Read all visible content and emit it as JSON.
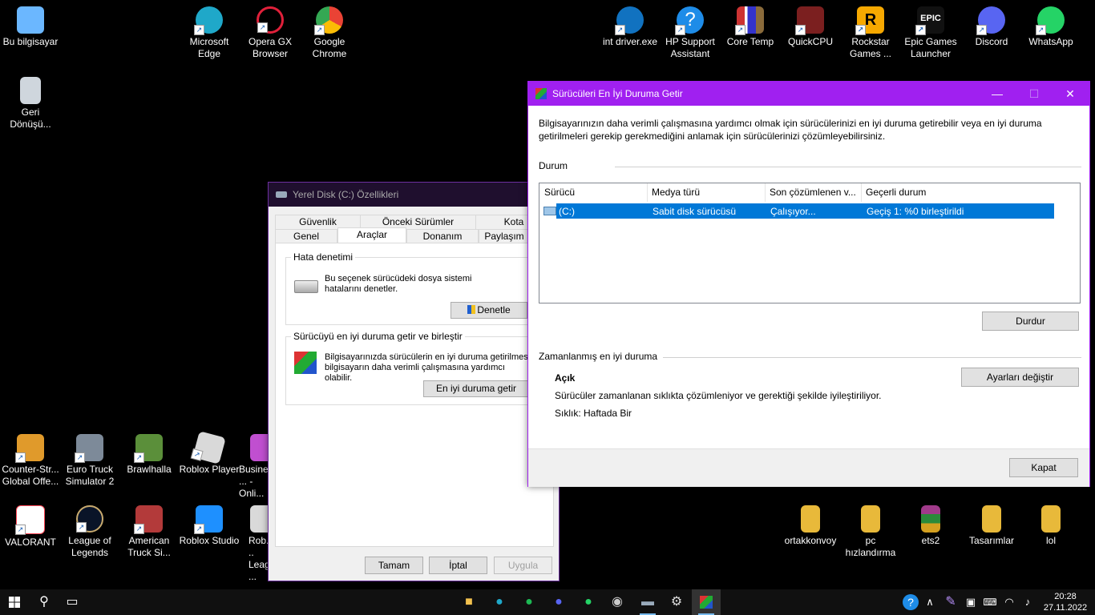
{
  "desktop": {
    "icons": [
      {
        "label": "Bu bilgisayar",
        "icon": "computer-icon",
        "color": "#6bb7ff"
      },
      {
        "label": "Geri Dönüşü...",
        "icon": "recycle-bin-icon",
        "color": "#cfd6dd"
      },
      {
        "label": "Microsoft Edge",
        "icon": "edge-icon",
        "color": "#1fa8c9"
      },
      {
        "label": "Opera GX Browser",
        "icon": "opera-gx-icon",
        "color": "#e0203a"
      },
      {
        "label": "Google Chrome",
        "icon": "chrome-icon",
        "color": "#4caf50"
      },
      {
        "label": "int driver.exe",
        "icon": "hp-icon",
        "color": "#1172c0"
      },
      {
        "label": "HP Support Assistant",
        "icon": "help-icon",
        "color": "#1e8ce8"
      },
      {
        "label": "Core Temp",
        "icon": "core-temp-icon",
        "color": "#8a6b3b"
      },
      {
        "label": "QuickCPU",
        "icon": "quickcpu-icon",
        "color": "#c83232"
      },
      {
        "label": "Rockstar Games ...",
        "icon": "rockstar-icon",
        "color": "#f6a800"
      },
      {
        "label": "Epic Games Launcher",
        "icon": "epic-icon",
        "color": "#222222"
      },
      {
        "label": "Discord",
        "icon": "discord-icon",
        "color": "#5865f2"
      },
      {
        "label": "WhatsApp",
        "icon": "whatsapp-icon",
        "color": "#25d366"
      },
      {
        "label": "Counter-Str... Global Offe...",
        "icon": "csgo-icon",
        "color": "#e09a2b"
      },
      {
        "label": "Euro Truck Simulator 2",
        "icon": "truck-icon",
        "color": "#7d8a99"
      },
      {
        "label": "Brawlhalla",
        "icon": "brawlhalla-icon",
        "color": "#5b8f3a"
      },
      {
        "label": "Roblox Player",
        "icon": "roblox-icon",
        "color": "#d9d9d9"
      },
      {
        "label": "Busine... - Onli...",
        "icon": "business-icon",
        "color": "#c04fd0"
      },
      {
        "label": "VALORANT",
        "icon": "valorant-icon",
        "color": "#ff4655"
      },
      {
        "label": "League of Legends",
        "icon": "lol-icon",
        "color": "#c8aa6e"
      },
      {
        "label": "American Truck Si...",
        "icon": "truck-icon",
        "color": "#b33a3a"
      },
      {
        "label": "Roblox Studio",
        "icon": "roblox-studio-icon",
        "color": "#1e90ff"
      },
      {
        "label": "Rob... Leag...",
        "icon": "roblox-icon",
        "color": "#d9d9d9"
      },
      {
        "label": "ortakkonvoy",
        "icon": "folder-icon",
        "color": "#e8b93a"
      },
      {
        "label": "pc hızlandırma",
        "icon": "folder-icon",
        "color": "#e8b93a"
      },
      {
        "label": "ets2",
        "icon": "archive-icon",
        "color": "#a03a8a"
      },
      {
        "label": "Tasarımlar",
        "icon": "folder-icon",
        "color": "#e8b93a"
      },
      {
        "label": "lol",
        "icon": "folder-icon",
        "color": "#e8b93a"
      }
    ]
  },
  "props_dialog": {
    "title": "Yerel Disk (C:) Özellikleri",
    "tabs_row1": [
      "Güvenlik",
      "Önceki Sürümler",
      "Kota"
    ],
    "tabs_row2": [
      "Genel",
      "Araçlar",
      "Donanım",
      "Paylaşım"
    ],
    "selected_tab": "Araçlar",
    "error_check": {
      "title": "Hata denetimi",
      "text": "Bu seçenek sürücüdeki dosya sistemi hatalarını denetler.",
      "button": "Denetle"
    },
    "optimize": {
      "title": "Sürücüyü en iyi duruma getir ve birleştir",
      "text": "Bilgisayarınızda sürücülerin en iyi duruma getirilmesi, bilgisayarın daha verimli çalışmasına yardımcı olabilir.",
      "button": "En iyi duruma getir"
    },
    "buttons": {
      "ok": "Tamam",
      "cancel": "İptal",
      "apply": "Uygula"
    }
  },
  "optimize_window": {
    "title": "Sürücüleri En İyi Duruma Getir",
    "intro": "Bilgisayarınızın daha verimli çalışmasına yardımcı olmak için sürücülerinizi en iyi duruma getirebilir veya en iyi duruma getirilmeleri gerekip gerekmediğini anlamak için sürücülerinizi çözümleyebilirsiniz.",
    "status_label": "Durum",
    "columns": [
      "Sürücü",
      "Medya türü",
      "Son çözümlenen v...",
      "Geçerli durum"
    ],
    "rows": [
      {
        "drive": "(C:)",
        "media": "Sabit disk sürücüsü",
        "last": "Çalışıyor...",
        "status": "Geçiş 1: %0 birleştirildi"
      }
    ],
    "stop_button": "Durdur",
    "scheduled": {
      "label": "Zamanlanmış en iyi duruma",
      "state": "Açık",
      "desc": "Sürücüler zamanlanan sıklıkta çözümleniyor ve gerektiği şekilde iyileştiriliyor.",
      "frequency": "Sıklık: Haftada Bir",
      "change_button": "Ayarları değiştir"
    },
    "close_button": "Kapat"
  },
  "taskbar": {
    "time": "20:28",
    "date": "27.11.2022",
    "colors": {
      "accent": "#76b9ed",
      "help": "#1e8ce8"
    }
  }
}
